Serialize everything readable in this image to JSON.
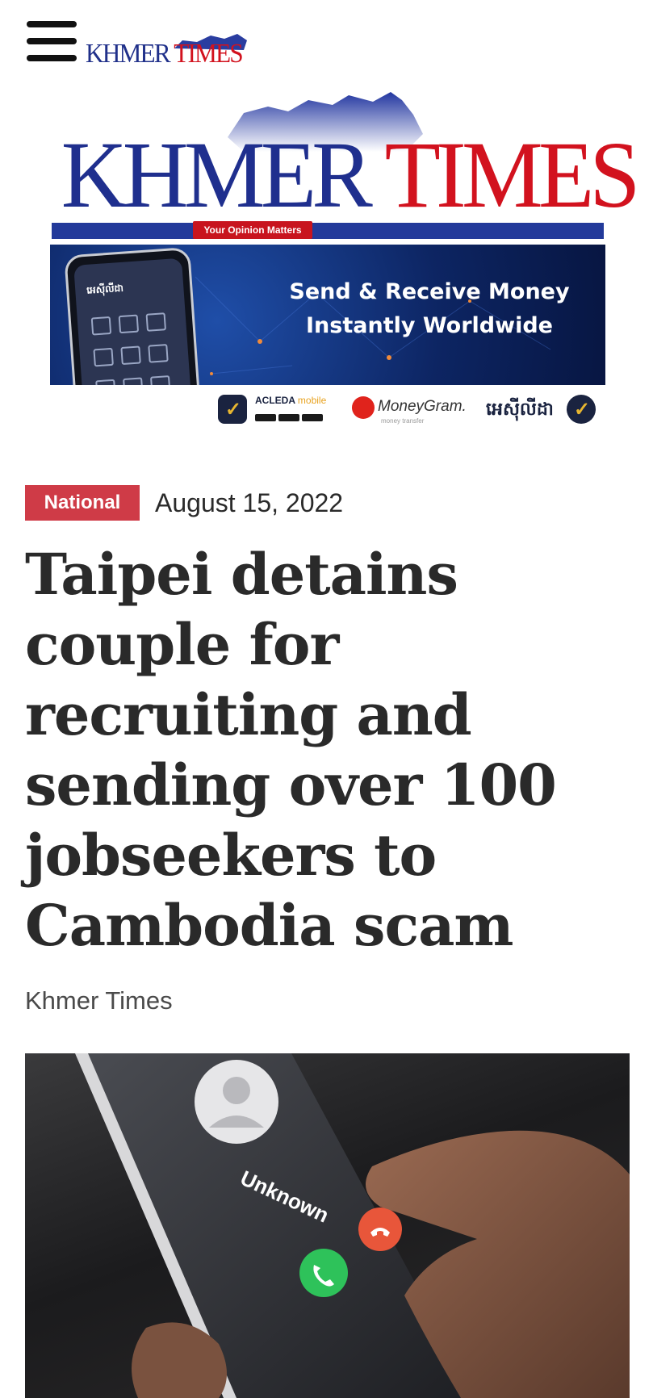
{
  "header": {
    "menu_icon": "hamburger-menu-icon",
    "logo_small": {
      "part1": "KHMER",
      "part2": "TIMES"
    }
  },
  "masthead": {
    "title_part1": "KHMER",
    "title_part2": "TIMES",
    "tagline": "Your Opinion Matters",
    "colors": {
      "blue": "#1f2f8e",
      "red": "#d2121e"
    }
  },
  "ad": {
    "headline_line1": "Send & Receive Money",
    "headline_line2": "Instantly Worldwide",
    "phone_app_title": "អេស៊ីលីដា",
    "acleda_label": "ACLEDA",
    "acleda_label_suffix": "mobile",
    "moneygram_label": "MoneyGram.",
    "moneygram_sub": "money transfer",
    "khmer_brand": "អេស៊ីលីដា"
  },
  "article": {
    "category": "National",
    "date": "August 15, 2022",
    "title": "Taipei detains couple for recruiting and sending over 100 jobseekers to Cambodia scam",
    "author": "Khmer Times",
    "category_color": "#cf3b47"
  },
  "hero_image": {
    "caller_label": "Unknown",
    "accept_icon": "phone-accept-icon",
    "decline_icon": "phone-decline-icon"
  }
}
